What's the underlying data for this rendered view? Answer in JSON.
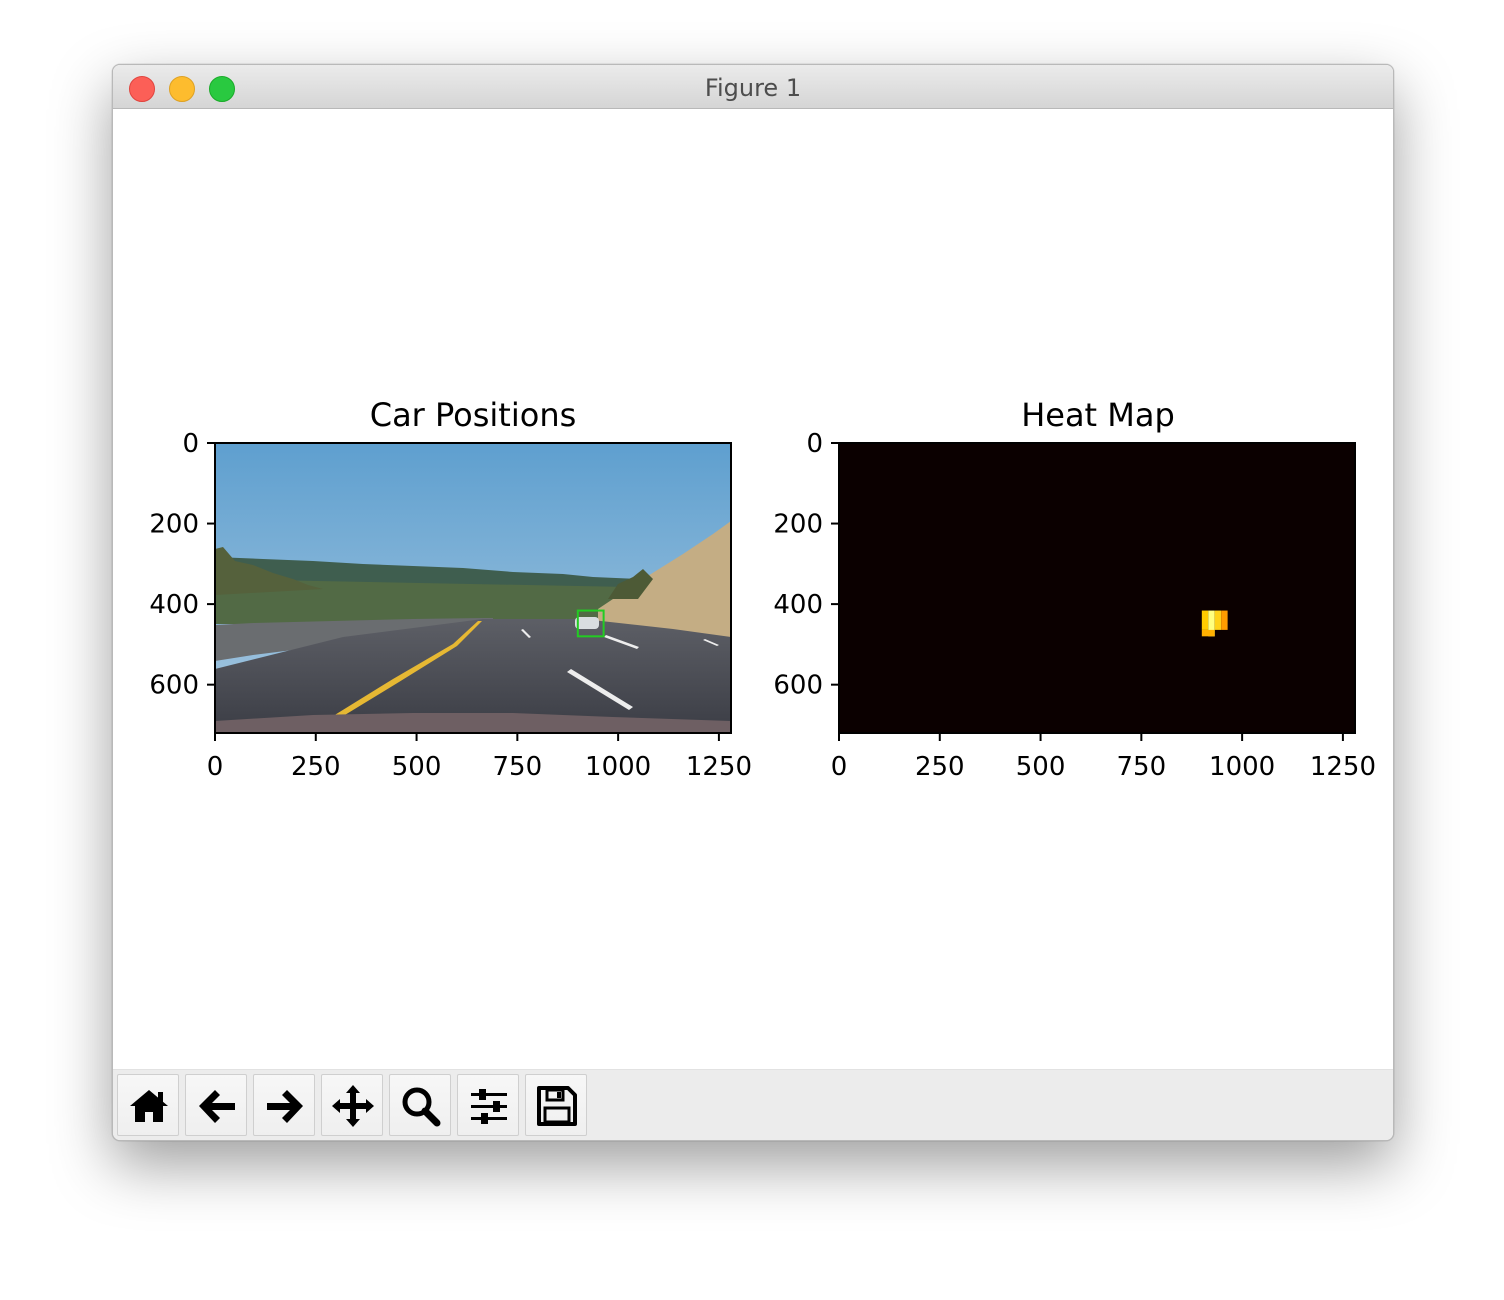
{
  "window": {
    "title": "Figure 1"
  },
  "toolbar": {
    "buttons": [
      {
        "name": "home",
        "icon": "home-icon"
      },
      {
        "name": "back",
        "icon": "arrow-left-icon"
      },
      {
        "name": "forward",
        "icon": "arrow-right-icon"
      },
      {
        "name": "pan",
        "icon": "move-icon"
      },
      {
        "name": "zoom",
        "icon": "zoom-icon"
      },
      {
        "name": "subplots",
        "icon": "sliders-icon"
      },
      {
        "name": "save",
        "icon": "save-icon"
      }
    ]
  },
  "chart_data": [
    {
      "type": "image",
      "title": "Car Positions",
      "x_ticks": [
        "0",
        "250",
        "500",
        "750",
        "1000",
        "1250"
      ],
      "y_ticks": [
        "0",
        "200",
        "400",
        "600"
      ],
      "xlim": [
        0,
        1280
      ],
      "ylim": [
        720,
        0
      ],
      "annotations": [
        {
          "kind": "bounding-box",
          "color": "#22cc22",
          "x0": 900,
          "y0": 416,
          "x1": 964,
          "y1": 480
        }
      ]
    },
    {
      "type": "heatmap",
      "title": "Heat Map",
      "x_ticks": [
        "0",
        "250",
        "500",
        "750",
        "1000",
        "1250"
      ],
      "y_ticks": [
        "0",
        "200",
        "400",
        "600"
      ],
      "xlim": [
        0,
        1280
      ],
      "ylim": [
        720,
        0
      ],
      "colormap": "hot",
      "background_color": "#0b0000",
      "hot_cells": [
        {
          "x0": 900,
          "y0": 416,
          "x1": 916,
          "y1": 464,
          "color": "#ffcc00"
        },
        {
          "x0": 916,
          "y0": 416,
          "x1": 932,
          "y1": 480,
          "color": "#ffff80"
        },
        {
          "x0": 932,
          "y0": 416,
          "x1": 948,
          "y1": 464,
          "color": "#ffd21a"
        },
        {
          "x0": 948,
          "y0": 416,
          "x1": 964,
          "y1": 464,
          "color": "#ff9c00"
        },
        {
          "x0": 900,
          "y0": 464,
          "x1": 932,
          "y1": 480,
          "color": "#ffb000"
        }
      ]
    }
  ]
}
